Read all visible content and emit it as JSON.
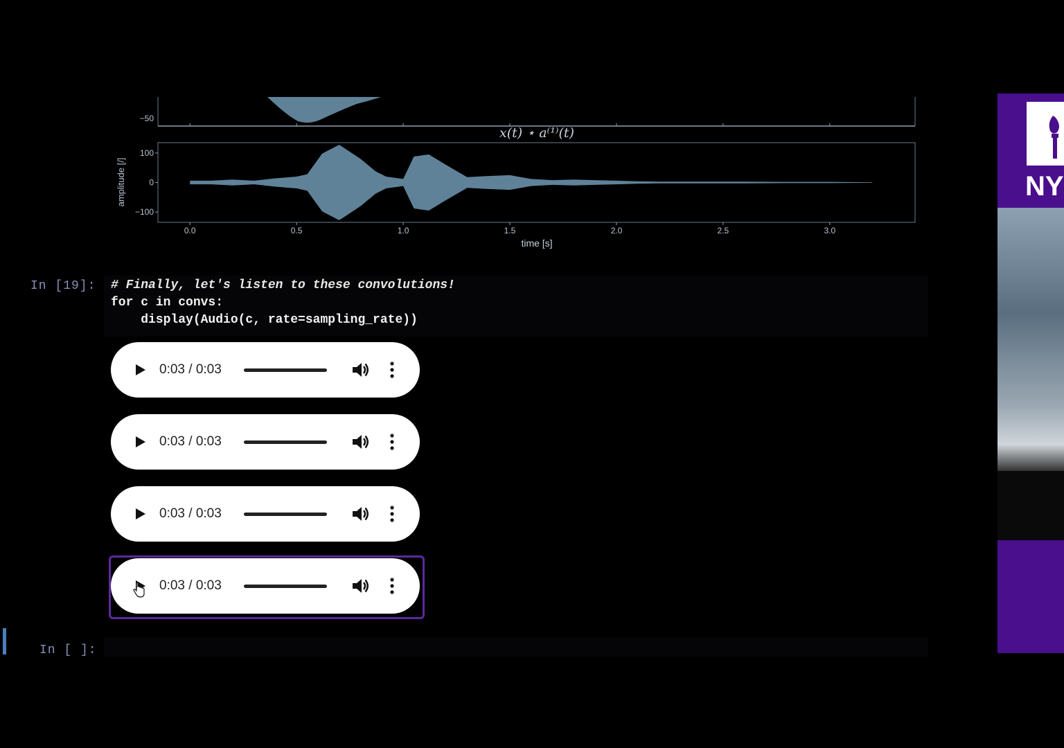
{
  "plot": {
    "top_axis_tick": "−50",
    "title": "x(t) ⋆ a⁽¹⁾(t)",
    "ylabel": "amplitude [/]",
    "xlabel": "time [s]",
    "yticks": [
      "100",
      "0",
      "−100"
    ],
    "xticks": [
      "0.0",
      "0.5",
      "1.0",
      "1.5",
      "2.0",
      "2.5",
      "3.0"
    ],
    "fill_color": "#5f8299"
  },
  "chart_data": {
    "type": "area",
    "title": "x(t) ⋆ a⁽¹⁾(t)",
    "xlabel": "time [s]",
    "ylabel": "amplitude [/]",
    "xlim": [
      -0.15,
      3.4
    ],
    "ylim": [
      -135,
      135
    ],
    "xticks": [
      0.0,
      0.5,
      1.0,
      1.5,
      2.0,
      2.5,
      3.0
    ],
    "yticks": [
      100,
      0,
      -100
    ],
    "series": [
      {
        "x": [
          0.0,
          0.1,
          0.2,
          0.3,
          0.4,
          0.5,
          0.55,
          0.62,
          0.7,
          0.8,
          0.87,
          0.92,
          1.0,
          1.05,
          1.12,
          1.2,
          1.3,
          1.4,
          1.5,
          1.6,
          1.7,
          1.8,
          1.9,
          2.0,
          2.1,
          2.2,
          2.4,
          2.6,
          2.8,
          3.0,
          3.2
        ],
        "envelope": [
          6,
          6,
          10,
          6,
          14,
          20,
          28,
          98,
          128,
          80,
          38,
          20,
          12,
          88,
          95,
          60,
          18,
          22,
          25,
          12,
          8,
          10,
          8,
          6,
          4,
          3,
          3,
          3,
          2,
          2,
          1
        ]
      }
    ]
  },
  "cell19": {
    "prompt": "In [19]:",
    "line1": "# Finally, let's listen to these convolutions!",
    "line2": "for c in convs:",
    "line3": "    display(Audio(c, rate=sampling_rate))"
  },
  "audio_players": [
    {
      "time": "0:03 / 0:03"
    },
    {
      "time": "0:03 / 0:03"
    },
    {
      "time": "0:03 / 0:03"
    },
    {
      "time": "0:03 / 0:03"
    }
  ],
  "empty_cell": {
    "prompt": "In [ ]:"
  },
  "sidebar": {
    "logo_text": "NY",
    "accent": "#4a0f8c"
  }
}
